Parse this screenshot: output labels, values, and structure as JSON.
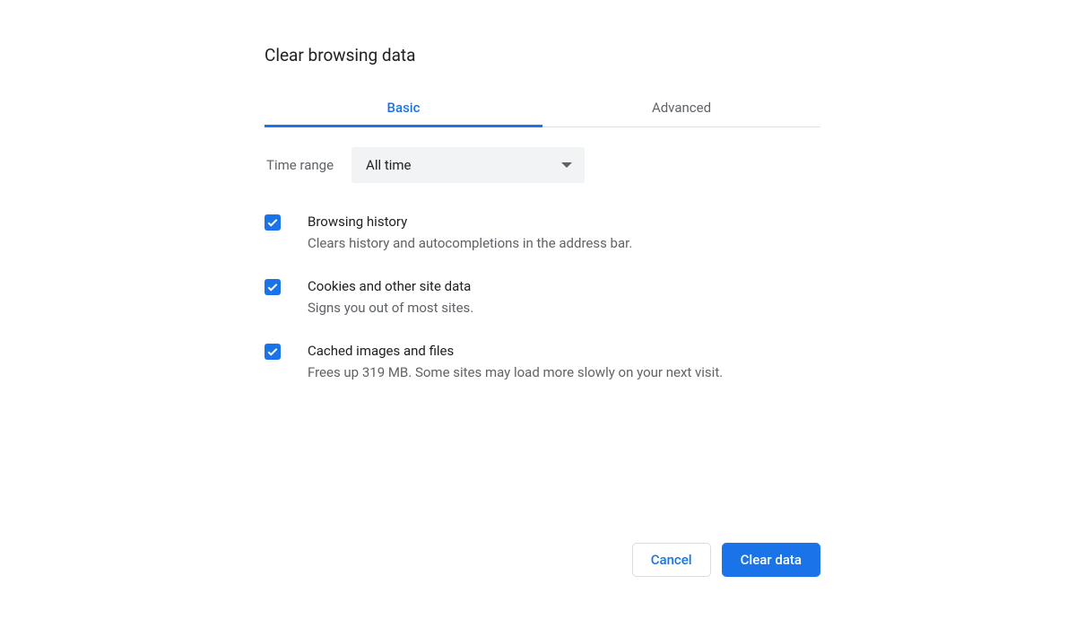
{
  "dialog": {
    "title": "Clear browsing data"
  },
  "tabs": {
    "basic": "Basic",
    "advanced": "Advanced"
  },
  "timeRange": {
    "label": "Time range",
    "value": "All time"
  },
  "options": {
    "history": {
      "title": "Browsing history",
      "desc": "Clears history and autocompletions in the address bar."
    },
    "cookies": {
      "title": "Cookies and other site data",
      "desc": "Signs you out of most sites."
    },
    "cache": {
      "title": "Cached images and files",
      "desc": "Frees up 319 MB. Some sites may load more slowly on your next visit."
    }
  },
  "buttons": {
    "cancel": "Cancel",
    "clear": "Clear data"
  }
}
